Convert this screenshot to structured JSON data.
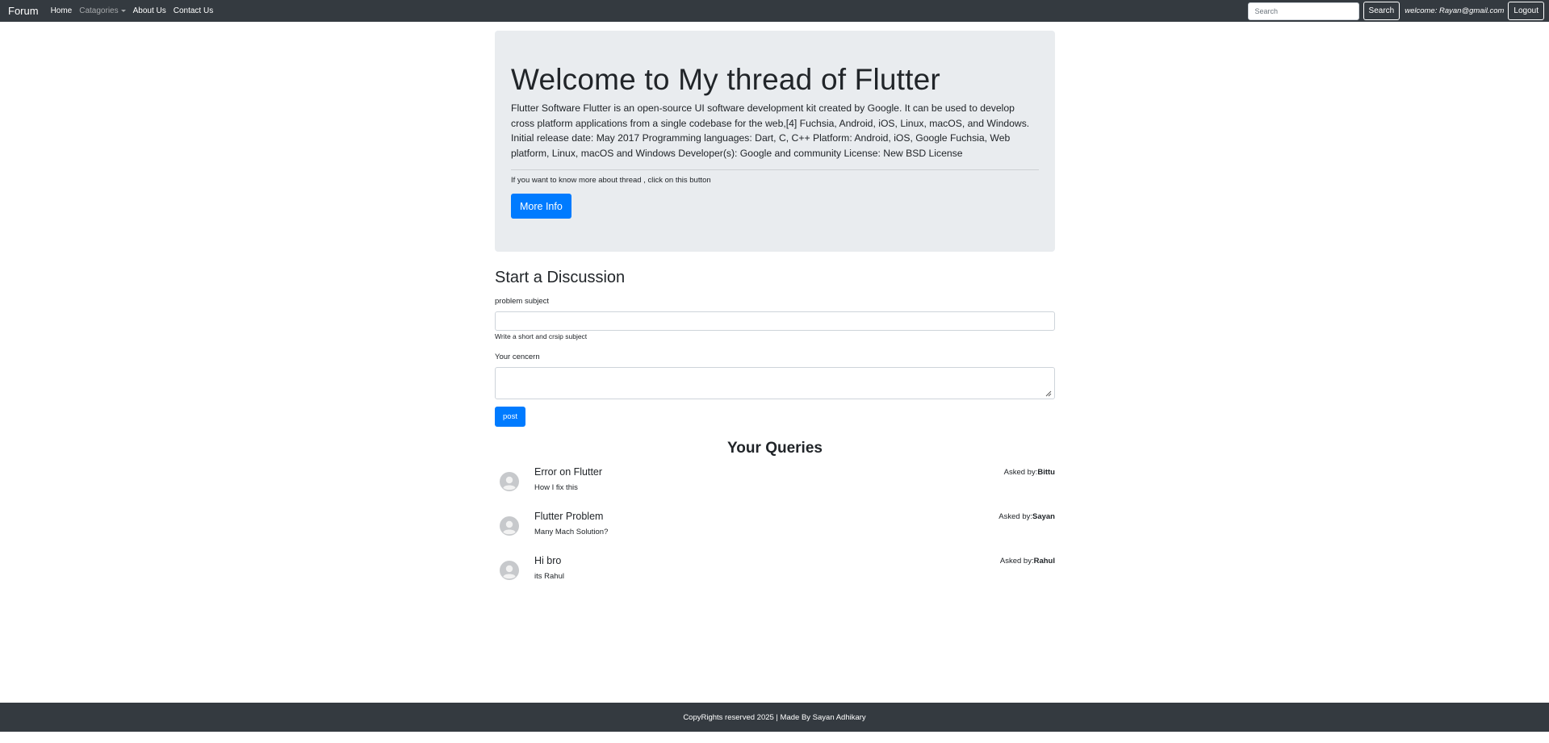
{
  "navbar": {
    "brand": "Forum",
    "links": {
      "home": "Home",
      "categories": "Catagories",
      "about": "About Us",
      "contact": "Contact Us"
    },
    "search_placeholder": "Search",
    "search_button": "Search",
    "welcome": "welcome: Rayan@gmail.com",
    "logout": "Logout"
  },
  "jumbotron": {
    "title": "Welcome to My thread of Flutter",
    "lead": "Flutter Software Flutter is an open-source UI software development kit created by Google. It can be used to develop cross platform applications from a single codebase for the web,[4] Fuchsia, Android, iOS, Linux, macOS, and Windows. Initial release date: May 2017 Programming languages: Dart, C, C++ Platform: Android, iOS, Google Fuchsia, Web platform, Linux, macOS and Windows Developer(s): Google and community License: New BSD License",
    "note": "If you want to know more about thread , click on this button",
    "button": "More Info"
  },
  "form": {
    "title": "Start a Discussion",
    "subject_label": "problem subject",
    "subject_value": "",
    "subject_help": "Write a short and crsip subject",
    "concern_label": "Your cencern",
    "concern_value": "",
    "submit": "post"
  },
  "queries": {
    "title": "Your Queries",
    "asked_by_prefix": "Asked by:",
    "items": [
      {
        "title": "Error on Flutter",
        "desc": "How I fix this",
        "author": "Bittu"
      },
      {
        "title": "Flutter Problem",
        "desc": "Many Mach Solution?",
        "author": "Sayan"
      },
      {
        "title": "Hi bro",
        "desc": "its Rahul",
        "author": "Rahul"
      }
    ]
  },
  "footer": {
    "text": "CopyRights reserved 2025 | Made By Sayan Adhikary"
  },
  "colors": {
    "navbar": "#343a40",
    "primary": "#007bff",
    "jumbotron": "#e9ecef"
  },
  "icons": {
    "avatar": "user-avatar-icon",
    "dropdown": "caret-down-icon"
  }
}
